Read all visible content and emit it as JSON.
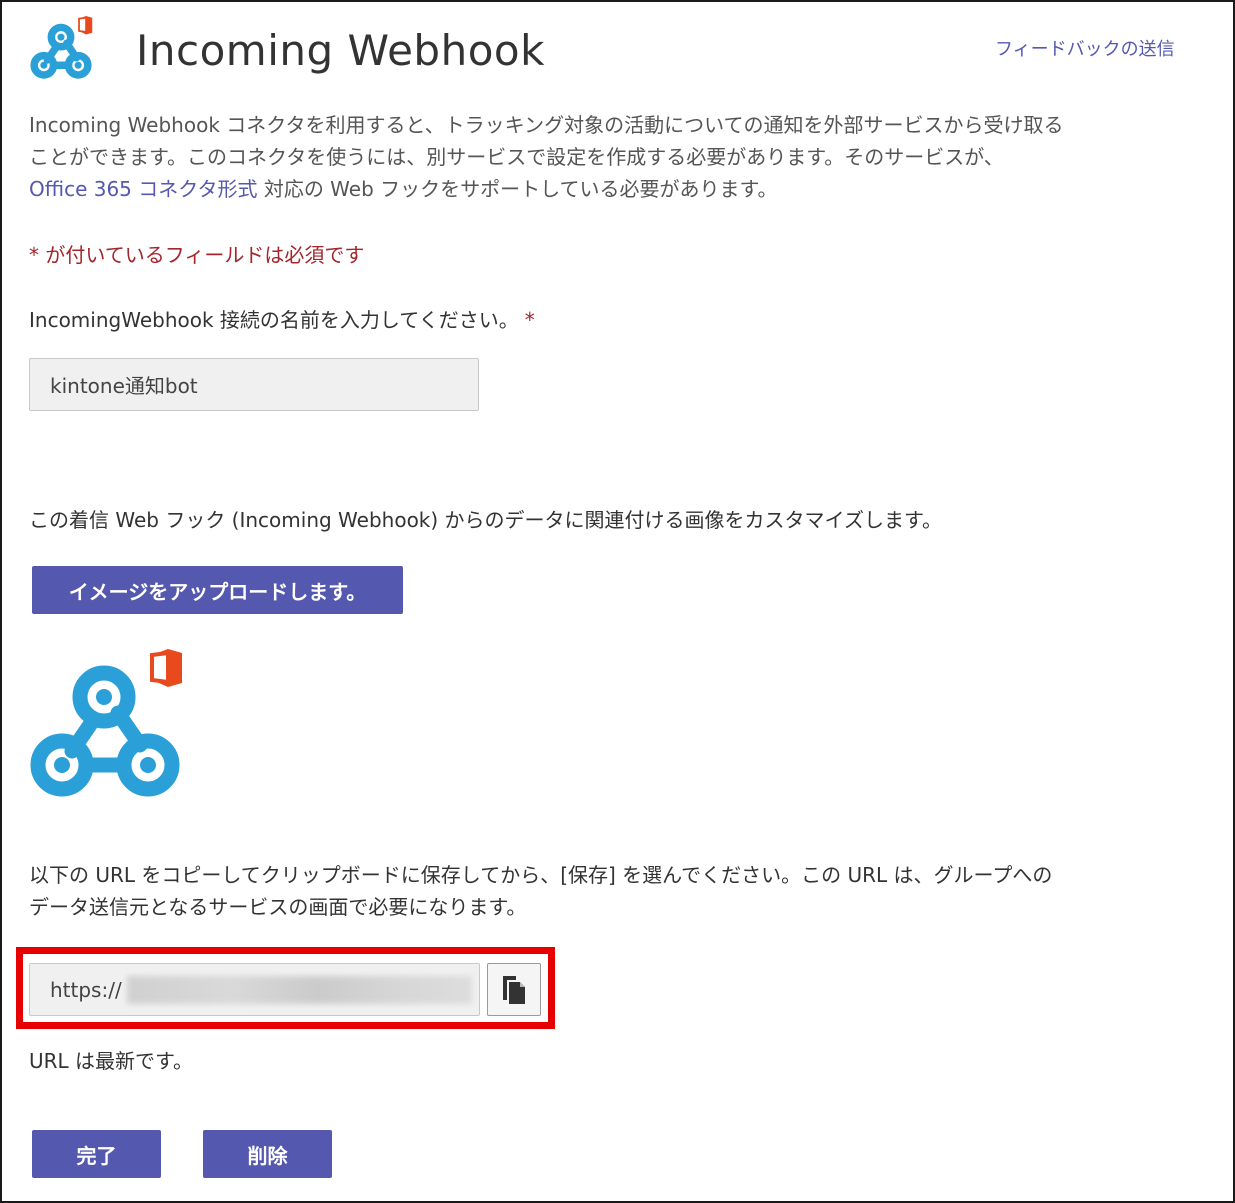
{
  "header": {
    "title": "Incoming Webhook",
    "feedback_link": "フィードバックの送信"
  },
  "description": {
    "line1": "Incoming Webhook コネクタを利用すると、トラッキング対象の活動についての通知を外部サービスから受け取る",
    "line2": "ことができます。このコネクタを使うには、別サービスで設定を作成する必要があります。そのサービスが、",
    "link_text": "Office 365 コネクタ形式",
    "line3_rest": " 対応の Web フックをサポートしている必要があります。"
  },
  "form": {
    "required_note": "* が付いているフィールドは必須です",
    "name_label": "IncomingWebhook 接続の名前を入力してください。",
    "required_star": "*",
    "name_value": "kintone通知bot",
    "customize_label": "この着信 Web フック (Incoming Webhook) からのデータに関連付ける画像をカスタマイズします。",
    "upload_button": "イメージをアップロードします。",
    "url_desc_line1": "以下の URL をコピーしてクリップボードに保存してから、[保存] を選んでください。この URL は、グループへの",
    "url_desc_line2": "データ送信元となるサービスの画面で必要になります。",
    "url_value": "https://",
    "url_status": "URL は最新です。"
  },
  "footer": {
    "done_button": "完了",
    "delete_button": "削除"
  },
  "colors": {
    "accent": "#5558af",
    "required": "#a4262c",
    "webhook_blue": "#2a9fd8",
    "office_red": "#e8491d",
    "highlight": "#e60000"
  },
  "icons": {
    "header_logo": "webhook-office-icon",
    "preview_image": "webhook-office-icon",
    "copy": "copy-icon"
  }
}
